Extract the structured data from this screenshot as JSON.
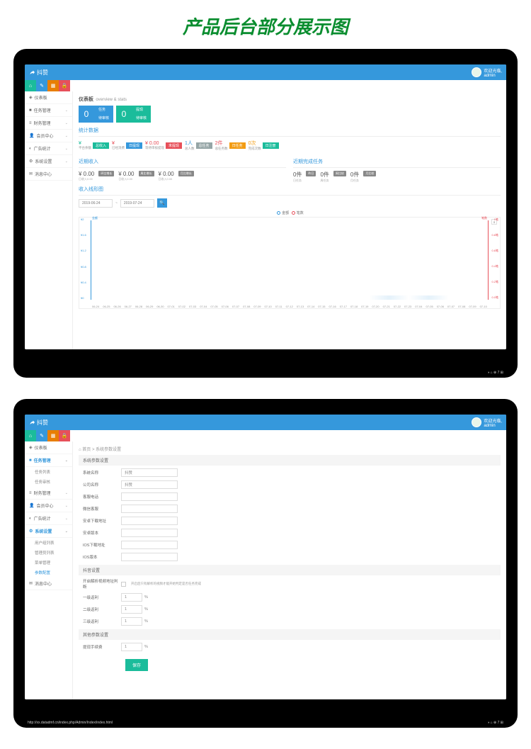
{
  "page_title": "产品后台部分展示图",
  "brand": "抖赞",
  "user": {
    "welcome": "欢迎光临,",
    "name": "admin"
  },
  "sidebar": {
    "items": [
      {
        "icon": "dash",
        "label": "仪表板"
      },
      {
        "icon": "task",
        "label": "任务管理",
        "chev": true
      },
      {
        "icon": "fin",
        "label": "财务管理",
        "chev": true
      },
      {
        "icon": "user",
        "label": "会员中心",
        "chev": true
      },
      {
        "icon": "ad",
        "label": "广告统计",
        "chev": true
      },
      {
        "icon": "sys",
        "label": "系统设置",
        "chev": true
      },
      {
        "icon": "msg",
        "label": "消息中心"
      }
    ]
  },
  "screen1": {
    "crumb_title": "仪表板",
    "crumb_sub": "overview & stats",
    "tiles": [
      {
        "num": "0",
        "l1": "任务",
        "l2": "待审核",
        "color": "blue"
      },
      {
        "num": "0",
        "l1": "提现",
        "l2": "待审核",
        "color": "green"
      }
    ],
    "sec_stats": "统计数据",
    "metrics": [
      {
        "val": "¥",
        "sub": "平台余额",
        "tag": "总收入",
        "tagc": "green"
      },
      {
        "val": "¥",
        "sub": "已经消费",
        "tag": "日提现",
        "tagc": "blue"
      },
      {
        "val": "¥ 0.00",
        "sub": "等待审核提现",
        "tag": "未提现",
        "tagc": "red"
      },
      {
        "val": "1人",
        "sub": "总人数",
        "tag": "总任务",
        "tagc": "gray"
      },
      {
        "val": "2件",
        "sub": "总任务数",
        "tag": "日任务",
        "tagc": "orange"
      },
      {
        "val": "0次",
        "sub": "完成次数",
        "tag": "日注册",
        "tagc": "green"
      }
    ],
    "sec_income": "近期收入",
    "sec_tasks": "近期完成任务",
    "income": [
      {
        "val": "¥ 0.00",
        "sub": "日收入0.00",
        "badge": "环比增长"
      },
      {
        "val": "¥ 0.00",
        "sub": "日收入0.00",
        "badge": "周比增长"
      },
      {
        "val": "¥ 0.00",
        "sub": "日收入0.00",
        "badge": "月比增长"
      }
    ],
    "tasks": [
      {
        "val": "0件",
        "sub": "日任务",
        "badge": "昨日"
      },
      {
        "val": "0件",
        "sub": "周任务",
        "badge": "周比较"
      },
      {
        "val": "0件",
        "sub": "月任务",
        "badge": "月比较"
      }
    ],
    "sec_chart": "收入线形图",
    "date_from": "2019-06-24",
    "date_to": "2019-07-24",
    "legend": {
      "a": "金额",
      "b": "笔数"
    },
    "axis_l": "金额",
    "axis_r": "笔数"
  },
  "screen2": {
    "crumb": "首页 > 系统参数设置",
    "sec1": "系统参数设置",
    "fields": [
      {
        "label": "系统名称",
        "val": "抖赞"
      },
      {
        "label": "公司名称",
        "val": "抖赞"
      },
      {
        "label": "客服电话",
        "val": ""
      },
      {
        "label": "微信客服",
        "val": ""
      },
      {
        "label": "安卓下载地址",
        "val": ""
      },
      {
        "label": "安卓版本",
        "val": ""
      },
      {
        "label": "IOS下载地址",
        "val": ""
      },
      {
        "label": "IOS版本",
        "val": ""
      }
    ],
    "sec2": "抖音设置",
    "row_check": {
      "label": "开启解析视频地址判断",
      "note": "开启后只有解析的视频才能开始判定是否任务完成"
    },
    "pct_rows": [
      {
        "label": "一级返利",
        "val": "1"
      },
      {
        "label": "二级返利",
        "val": "1"
      },
      {
        "label": "三级返利",
        "val": "1"
      }
    ],
    "sec3": "其他参数设置",
    "fee": {
      "label": "提现手续费",
      "val": "1"
    },
    "save": "保存",
    "url": "http://xx.datadmf.cn/index.php/Admin/Index/index.html"
  },
  "chart_data": {
    "type": "line",
    "x": [
      "06-24",
      "06-25",
      "06-26",
      "06-27",
      "06-28",
      "06-29",
      "06-30",
      "07-01",
      "07-02",
      "07-03",
      "07-04",
      "07-05",
      "07-06",
      "07-07",
      "07-08",
      "07-09",
      "07-10",
      "07-11",
      "07-12",
      "07-13",
      "07-14",
      "07-15",
      "07-16",
      "07-17",
      "07-18",
      "07-19",
      "07-20",
      "07-21",
      "07-22",
      "07-23",
      "07-04",
      "07-05",
      "07-06",
      "07-07",
      "07-08",
      "07-09",
      "07-10"
    ],
    "series": [
      {
        "name": "金额",
        "values": [
          0,
          0,
          0,
          0,
          0,
          0,
          0,
          0,
          0,
          0,
          0,
          0,
          0,
          0,
          0,
          0,
          0,
          0,
          0,
          0,
          0,
          0,
          0,
          0,
          0,
          0,
          0,
          0,
          0,
          0,
          0,
          0,
          0,
          0,
          0,
          0,
          0
        ],
        "color": "#3598dc",
        "ylim": [
          0,
          2
        ],
        "yticks": [
          "¥2",
          "¥1.6",
          "¥1.2",
          "¥0.8",
          "¥0.4",
          "¥0"
        ]
      },
      {
        "name": "笔数",
        "values": [
          0,
          0,
          0,
          0,
          0,
          0,
          0,
          0,
          0,
          0,
          0,
          0,
          0,
          0,
          0,
          0,
          0,
          0,
          0,
          0,
          0,
          0,
          0,
          0,
          0,
          0,
          0,
          0,
          0,
          0,
          0,
          0,
          0,
          0,
          0,
          0,
          0.1
        ],
        "color": "#e7505a",
        "ylim": [
          0,
          1
        ],
        "yticks": [
          "1笔",
          "0.8笔",
          "0.6笔",
          "0.4笔",
          "0.2笔",
          "0.0笔"
        ]
      }
    ]
  }
}
